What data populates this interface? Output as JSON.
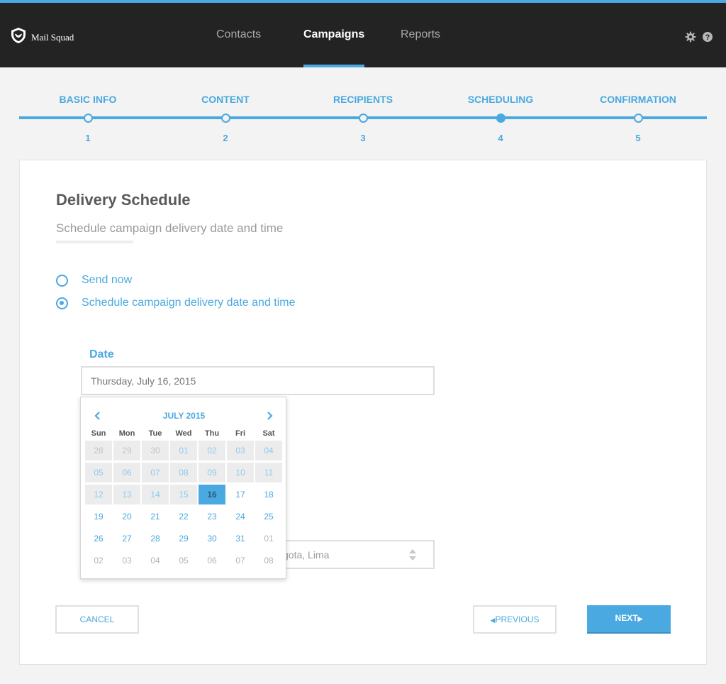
{
  "app": {
    "name": "Mail Squad"
  },
  "nav": {
    "contacts": "Contacts",
    "campaigns": "Campaigns",
    "reports": "Reports"
  },
  "stepper": {
    "steps": [
      {
        "label": "BASIC INFO",
        "number": "1"
      },
      {
        "label": "CONTENT",
        "number": "2"
      },
      {
        "label": "RECIPIENTS",
        "number": "3"
      },
      {
        "label": "SCHEDULING",
        "number": "4"
      },
      {
        "label": "CONFIRMATION",
        "number": "5"
      }
    ],
    "current_step": 4
  },
  "card": {
    "title": "Delivery Schedule",
    "subtitle": "Schedule campaign delivery date and time",
    "options": [
      {
        "label": "Send now",
        "checked": false
      },
      {
        "label": "Schedule campaign delivery date and time",
        "checked": true
      }
    ],
    "date": {
      "label": "Date",
      "value": "Thursday, July 16, 2015"
    },
    "timezone": {
      "visible_text": "gota, Lima"
    }
  },
  "calendar": {
    "title": "JULY 2015",
    "weekdays": [
      "Sun",
      "Mon",
      "Tue",
      "Wed",
      "Thu",
      "Fri",
      "Sat"
    ],
    "weeks": [
      [
        "28",
        "29",
        "30",
        "01",
        "02",
        "03",
        "04"
      ],
      [
        "05",
        "06",
        "07",
        "08",
        "09",
        "10",
        "11"
      ],
      [
        "12",
        "13",
        "14",
        "15",
        "16",
        "17",
        "18"
      ],
      [
        "19",
        "20",
        "21",
        "22",
        "23",
        "24",
        "25"
      ],
      [
        "26",
        "27",
        "28",
        "29",
        "30",
        "31",
        "01"
      ],
      [
        "02",
        "03",
        "04",
        "05",
        "06",
        "07",
        "08"
      ]
    ],
    "selected": "16"
  },
  "buttons": {
    "cancel": "CANCEL",
    "previous": "PREVIOUS",
    "next": "NEXT"
  },
  "colors": {
    "accent": "#4aa9e0",
    "topbar": "#232323",
    "background": "#f3f3f3"
  }
}
